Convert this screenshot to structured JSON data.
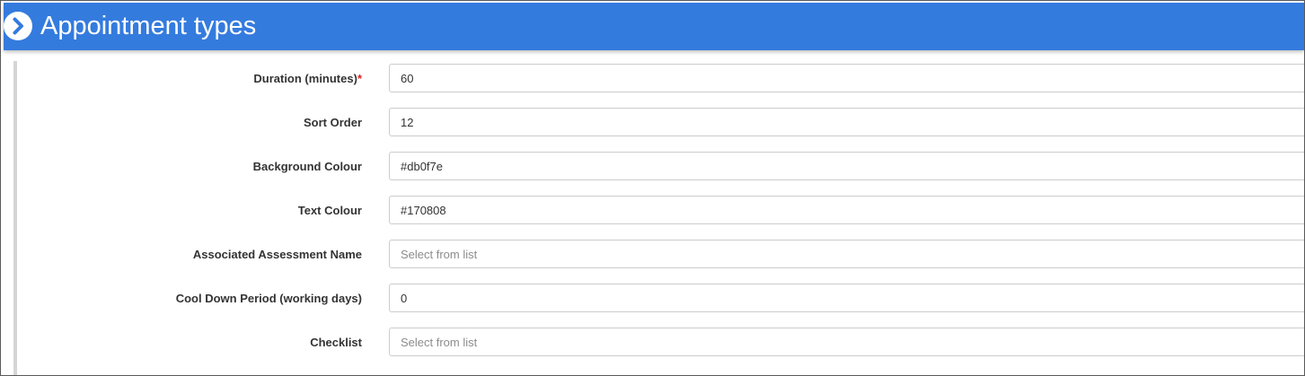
{
  "header": {
    "title": "Appointment types",
    "icon": "chevron-right-circle-icon",
    "color": "#347bde"
  },
  "form": {
    "fields": [
      {
        "label": "Duration (minutes)",
        "required_marker": "*",
        "value": "60",
        "placeholder": ""
      },
      {
        "label": "Sort Order",
        "value": "12",
        "placeholder": ""
      },
      {
        "label": "Background Colour",
        "value": "#db0f7e",
        "placeholder": ""
      },
      {
        "label": "Text Colour",
        "value": "#170808",
        "placeholder": ""
      },
      {
        "label": "Associated Assessment Name",
        "value": "",
        "placeholder": "Select from list"
      },
      {
        "label": "Cool Down Period (working days)",
        "value": "0",
        "placeholder": ""
      },
      {
        "label": "Checklist",
        "value": "",
        "placeholder": "Select from list"
      }
    ]
  }
}
